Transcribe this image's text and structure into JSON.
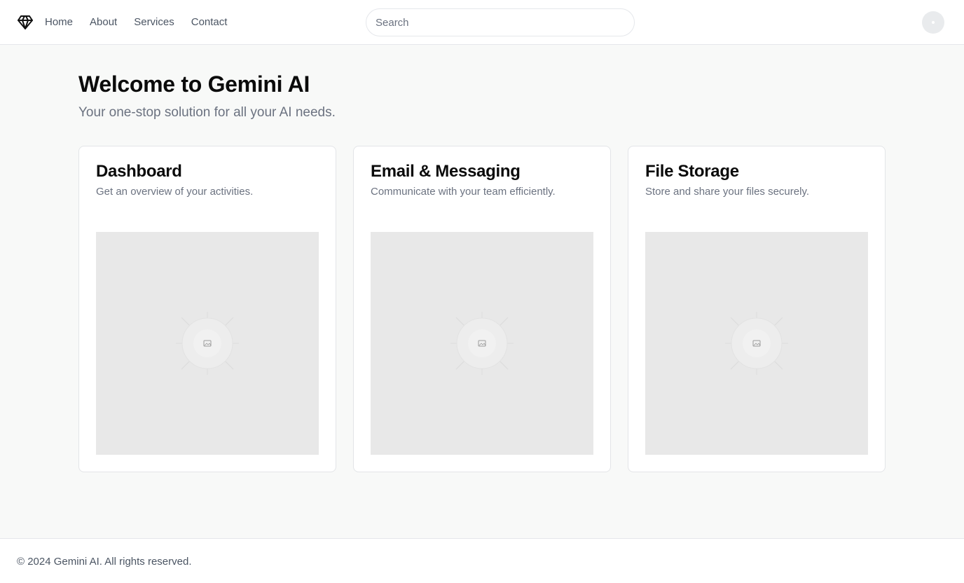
{
  "header": {
    "logo_icon": "diamond-icon",
    "nav": [
      {
        "label": "Home"
      },
      {
        "label": "About"
      },
      {
        "label": "Services"
      },
      {
        "label": "Contact"
      }
    ],
    "search": {
      "placeholder": "Search",
      "value": ""
    },
    "avatar_icon": "avatar-placeholder"
  },
  "hero": {
    "title": "Welcome to Gemini AI",
    "subtitle": "Your one-stop solution for all your AI needs."
  },
  "cards": [
    {
      "title": "Dashboard",
      "description": "Get an overview of your activities.",
      "image_icon": "image-placeholder-icon"
    },
    {
      "title": "Email & Messaging",
      "description": "Communicate with your team efficiently.",
      "image_icon": "image-placeholder-icon"
    },
    {
      "title": "File Storage",
      "description": "Store and share your files securely.",
      "image_icon": "image-placeholder-icon"
    }
  ],
  "footer": {
    "text": "© 2024 Gemini AI. All rights reserved."
  },
  "colors": {
    "background": "#f8f9f8",
    "surface": "#ffffff",
    "text_primary": "#0b0b0b",
    "text_muted": "#6b7280",
    "border": "#e5e7eb",
    "placeholder": "#e8e8e8"
  }
}
